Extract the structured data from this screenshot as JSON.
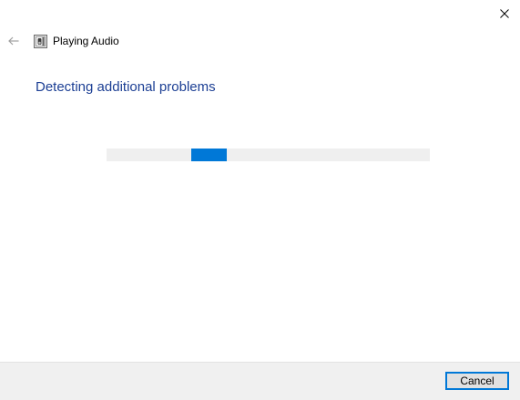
{
  "window": {
    "title": "Playing Audio",
    "close_icon": "close-icon",
    "back_icon": "back-arrow-icon",
    "app_icon": "audio-troubleshooter-icon"
  },
  "main": {
    "heading": "Detecting additional problems",
    "progress": {
      "mode": "indeterminate",
      "accent_color": "#0078d7",
      "track_color": "#efefef"
    }
  },
  "footer": {
    "cancel_label": "Cancel"
  },
  "colors": {
    "heading": "#1c3f94",
    "accent": "#0078d7",
    "footer_bg": "#f0f0f0"
  }
}
